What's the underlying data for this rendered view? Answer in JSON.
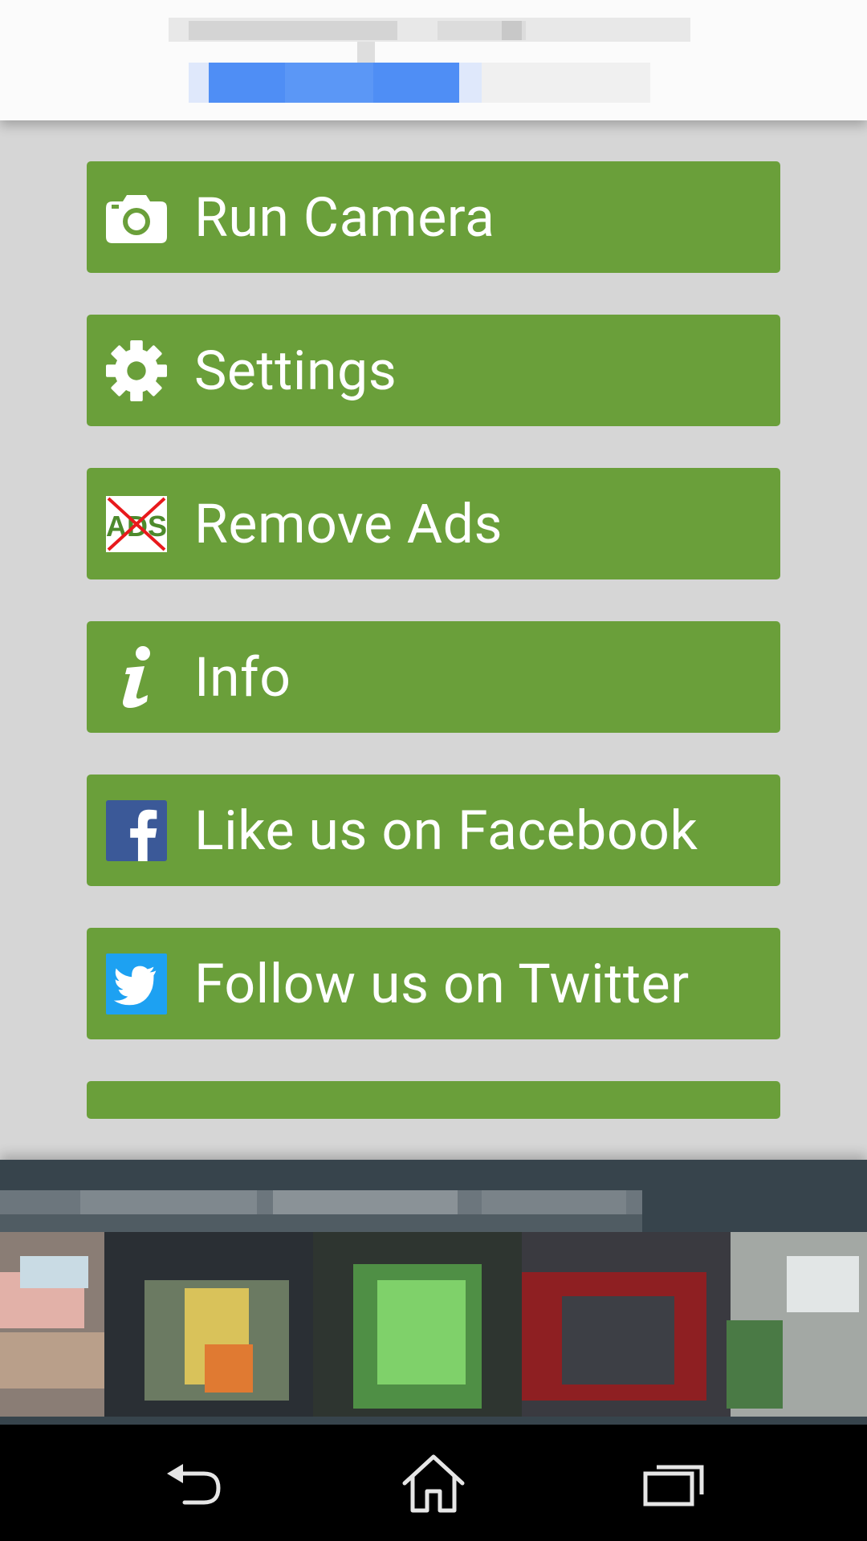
{
  "menu": {
    "items": [
      {
        "label": "Run Camera",
        "icon": "camera-icon"
      },
      {
        "label": "Settings",
        "icon": "gear-icon"
      },
      {
        "label": "Remove Ads",
        "icon": "no-ads-icon",
        "icon_text": "ADS"
      },
      {
        "label": "Info",
        "icon": "info-icon"
      },
      {
        "label": "Like us on Facebook",
        "icon": "facebook-icon"
      },
      {
        "label": "Follow us on Twitter",
        "icon": "twitter-icon"
      }
    ]
  },
  "navbar": {
    "items": [
      {
        "icon": "back-icon"
      },
      {
        "icon": "home-icon"
      },
      {
        "icon": "recent-apps-icon"
      }
    ]
  },
  "colors": {
    "button_green": "#6a9f3a",
    "background": "#d6d6d6",
    "facebook_blue": "#3b5998",
    "twitter_blue": "#1da1f2",
    "ad_banner": "#37444c",
    "navbar": "#000000"
  }
}
